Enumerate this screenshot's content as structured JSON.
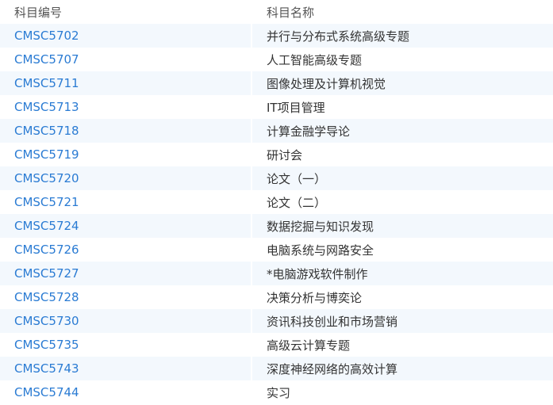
{
  "table": {
    "headers": {
      "code": "科目编号",
      "name": "科目名称"
    },
    "rows": [
      {
        "code": "CMSC5702",
        "name": "并行与分布式系统高级专题"
      },
      {
        "code": "CMSC5707",
        "name": "人工智能高级专题"
      },
      {
        "code": "CMSC5711",
        "name": "图像处理及计算机视觉"
      },
      {
        "code": "CMSC5713",
        "name": "IT项目管理"
      },
      {
        "code": "CMSC5718",
        "name": "计算金融学导论"
      },
      {
        "code": "CMSC5719",
        "name": "研讨会"
      },
      {
        "code": "CMSC5720",
        "name": "论文（一）"
      },
      {
        "code": "CMSC5721",
        "name": "论文（二）"
      },
      {
        "code": "CMSC5724",
        "name": "数据挖掘与知识发现"
      },
      {
        "code": "CMSC5726",
        "name": "电脑系统与网路安全"
      },
      {
        "code": "CMSC5727",
        "name": "*电脑游戏软件制作"
      },
      {
        "code": "CMSC5728",
        "name": "决策分析与博奕论"
      },
      {
        "code": "CMSC5730",
        "name": "资讯科技创业和市场营销"
      },
      {
        "code": "CMSC5735",
        "name": "高级云计算专题"
      },
      {
        "code": "CMSC5743",
        "name": "深度神经网络的高效计算"
      },
      {
        "code": "CMSC5744",
        "name": "实习"
      }
    ]
  },
  "colors": {
    "link": "#2a7bd3",
    "stripe": "#f3f8fd",
    "text": "#333333"
  }
}
